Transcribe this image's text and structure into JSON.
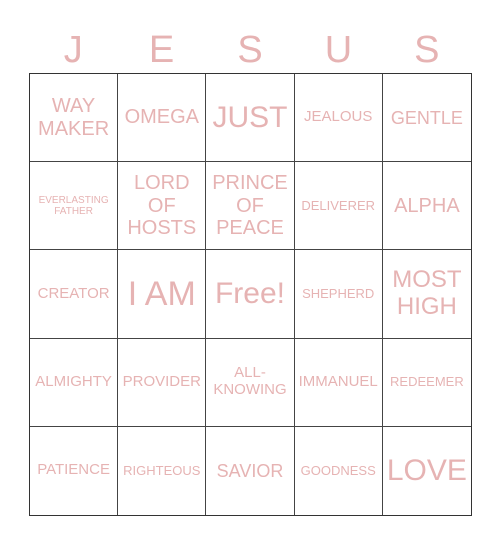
{
  "title_letters": [
    "J",
    "E",
    "S",
    "U",
    "S"
  ],
  "text_color": "#e6b3b3",
  "cells": [
    [
      "WAY MAKER",
      "OMEGA",
      "JUST",
      "JEALOUS",
      "GENTLE"
    ],
    [
      "EVERLASTING FATHER",
      "LORD OF HOSTS",
      "PRINCE OF PEACE",
      "DELIVERER",
      "ALPHA"
    ],
    [
      "CREATOR",
      "I AM",
      "Free!",
      "SHEPHERD",
      "MOST HIGH"
    ],
    [
      "ALMIGHTY",
      "PROVIDER",
      "ALL-KNOWING",
      "IMMANUEL",
      "REDEEMER"
    ],
    [
      "PATIENCE",
      "RIGHTEOUS",
      "SAVIOR",
      "GOODNESS",
      "LOVE"
    ]
  ]
}
